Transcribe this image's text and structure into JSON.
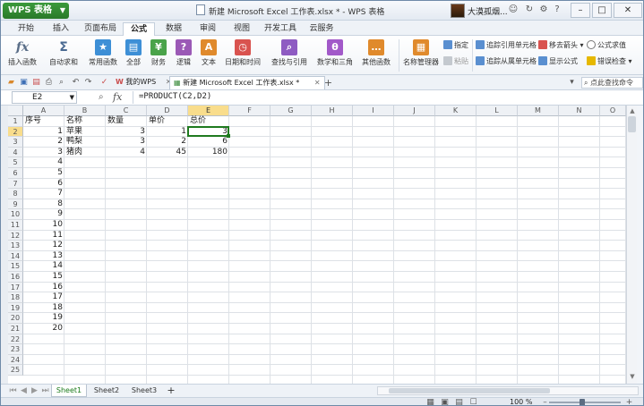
{
  "titlebar": {
    "app_button": "WPS 表格",
    "title": "新建 Microsoft Excel 工作表.xlsx * - WPS 表格",
    "user_name": "大漠孤烟..."
  },
  "menu": [
    "开始",
    "插入",
    "页面布局",
    "公式",
    "数据",
    "审阅",
    "视图",
    "开发工具",
    "云服务"
  ],
  "ribbon": {
    "insert_function": "插入函数",
    "autosum": "自动求和",
    "common": "常用函数",
    "all": "全部",
    "finance": "财务",
    "logic": "逻辑",
    "text": "文本",
    "datetime": "日期和时间",
    "lookup": "查找与引用",
    "math": "数学和三角",
    "other": "其他函数",
    "name_manager": "名称管理器",
    "define": "指定",
    "paste": "粘贴",
    "trace_precedents": "追踪引用单元格",
    "trace_dependents": "追踪从属单元格",
    "remove_arrows": "移去箭头",
    "show_formulas": "显示公式",
    "formula_eval": "公式求值",
    "error_check": "错误检查"
  },
  "tabs": {
    "my_wps": "我的WPS",
    "doc": "新建 Microsoft Excel 工作表.xlsx *",
    "find_placeholder": "点此查找命令"
  },
  "formula_bar": {
    "cell_ref": "E2",
    "formula": "=PRODUCT(C2,D2)"
  },
  "columns": [
    "A",
    "B",
    "C",
    "D",
    "E",
    "F",
    "G",
    "H",
    "I",
    "J",
    "K",
    "L",
    "M",
    "N",
    "O"
  ],
  "rows": [
    "1",
    "2",
    "3",
    "4",
    "5",
    "6",
    "7",
    "8",
    "9",
    "10",
    "11",
    "12",
    "13",
    "14",
    "15",
    "16",
    "17",
    "18",
    "19",
    "20",
    "21",
    "22",
    "23",
    "24",
    "25"
  ],
  "sheet": {
    "headers": [
      "序号",
      "名称",
      "数量",
      "单价",
      "总价"
    ],
    "data": [
      [
        "1",
        "苹果",
        "3",
        "1",
        "3"
      ],
      [
        "2",
        "鸭梨",
        "3",
        "2",
        "6"
      ],
      [
        "3",
        "猪肉",
        "4",
        "45",
        "180"
      ]
    ],
    "serials": [
      "4",
      "5",
      "6",
      "7",
      "8",
      "9",
      "10",
      "11",
      "12",
      "13",
      "14",
      "15",
      "16",
      "17",
      "18",
      "19",
      "20"
    ]
  },
  "sheets": [
    "Sheet1",
    "Sheet2",
    "Sheet3"
  ],
  "status": {
    "zoom": "100 %"
  }
}
